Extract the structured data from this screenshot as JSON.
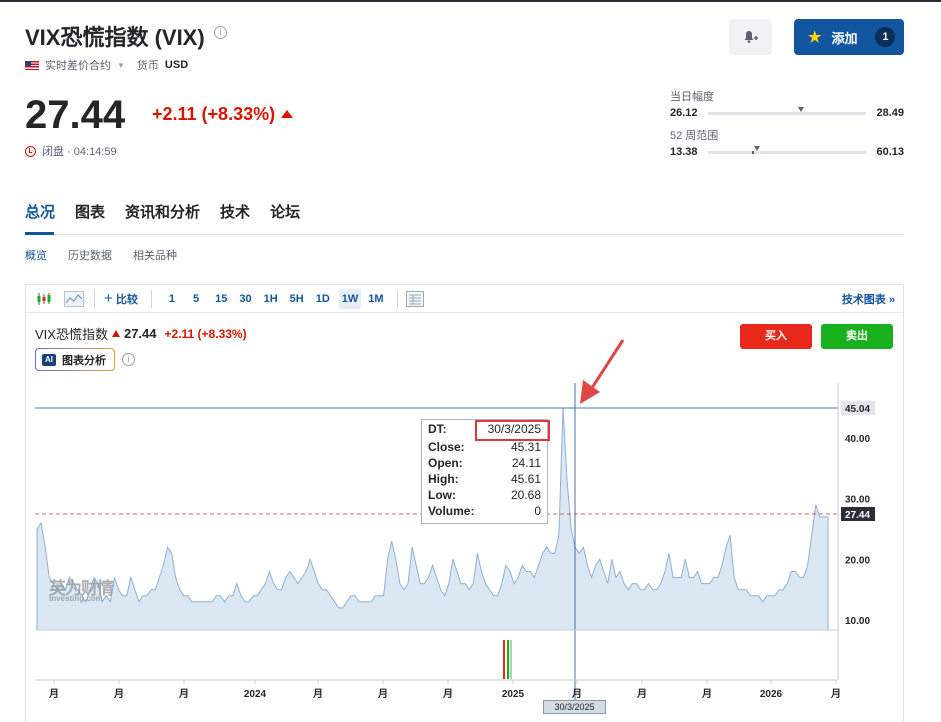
{
  "header": {
    "title": "VIX恐慌指数 (VIX)",
    "contract_type": "实时差价合约",
    "currency_label": "货币",
    "currency_value": "USD",
    "price": "27.44",
    "change": "+2.11 (+8.33%)",
    "status": "闭盘 · 04:14:59",
    "add_label": "添加",
    "add_count": "1"
  },
  "ranges": {
    "day_label": "当日幅度",
    "day_low": "26.12",
    "day_high": "28.49",
    "week52_label": "52 周范围",
    "week52_low": "13.38",
    "week52_high": "60.13"
  },
  "tabs": [
    "总况",
    "图表",
    "资讯和分析",
    "技术",
    "论坛"
  ],
  "subtabs": [
    "概览",
    "历史数据",
    "相关品种"
  ],
  "toolbar": {
    "compare_label": "比较",
    "intervals": [
      "1",
      "5",
      "15",
      "30",
      "1H",
      "5H",
      "1D",
      "1W",
      "1M"
    ],
    "active_interval": "1W",
    "tech_chart_label": "技术图表 »"
  },
  "chart_header": {
    "name": "VIX恐慌指数",
    "price": "27.44",
    "change": "+2.11 (+8.33%)",
    "ai_label": "图表分析",
    "ai_badge": "AI",
    "buy_label": "买入",
    "sell_label": "卖出"
  },
  "tooltip": {
    "dt_label": "DT:",
    "dt_value": "30/3/2025",
    "close_label": "Close:",
    "close_value": "45.31",
    "open_label": "Open:",
    "open_value": "24.11",
    "high_label": "High:",
    "high_value": "45.61",
    "low_label": "Low:",
    "low_value": "20.68",
    "volume_label": "Volume:",
    "volume_value": "0"
  },
  "crosshair_date": "30/3/2025",
  "watermark": {
    "main": "英为财情",
    "sub": "Investing.com"
  },
  "chart_data": {
    "type": "area",
    "series": [
      {
        "values": [
          25,
          26,
          22,
          17,
          16,
          15,
          16,
          15,
          17,
          16,
          15,
          14,
          13,
          15,
          17,
          16,
          13,
          14,
          13,
          17,
          15,
          14,
          14,
          17,
          15,
          13,
          14,
          14,
          15,
          15,
          17,
          19,
          22,
          21,
          17,
          15,
          14,
          14,
          13,
          13,
          13,
          13,
          13,
          13,
          14,
          14,
          13,
          14,
          14,
          16,
          14,
          13,
          13,
          14,
          14,
          15,
          16,
          18,
          16,
          15,
          15,
          17,
          18,
          17,
          16,
          17,
          18,
          20,
          18,
          16,
          15,
          15,
          14,
          13,
          12,
          12,
          13,
          14,
          14,
          13,
          13,
          13,
          13,
          14,
          14,
          14,
          20,
          23,
          20,
          16,
          15,
          16,
          22,
          19,
          16,
          16,
          17,
          19,
          17,
          15,
          14,
          16,
          20,
          18,
          16,
          16,
          15,
          16,
          21,
          18,
          16,
          15,
          14,
          14,
          16,
          19,
          18,
          16,
          17,
          19,
          18,
          18,
          17,
          19,
          21,
          22,
          21,
          21,
          24,
          45,
          33,
          25,
          22,
          21,
          22,
          19,
          17,
          19,
          20,
          18,
          16,
          20,
          17,
          18,
          16,
          15,
          16,
          16,
          15,
          15,
          16,
          15,
          15,
          16,
          18,
          21,
          17,
          17,
          17,
          20,
          17,
          17,
          18,
          16,
          16,
          16,
          17,
          17,
          19,
          22,
          24,
          17,
          15,
          15,
          15,
          14,
          14,
          14,
          13,
          14,
          14,
          14,
          15,
          15,
          16,
          18,
          18,
          17,
          17,
          19,
          24,
          29,
          27,
          27,
          27
        ]
      }
    ],
    "y_ticks": [
      "10.00",
      "20.00",
      "30.00",
      "40.00"
    ],
    "x_ticks": [
      "月",
      "月",
      "月",
      "2024",
      "月",
      "月",
      "月",
      "2025",
      "月",
      "月",
      "月",
      "2026",
      "月"
    ],
    "price_label": "27.44",
    "high_label": "45.04",
    "ylim": [
      5,
      48
    ]
  }
}
